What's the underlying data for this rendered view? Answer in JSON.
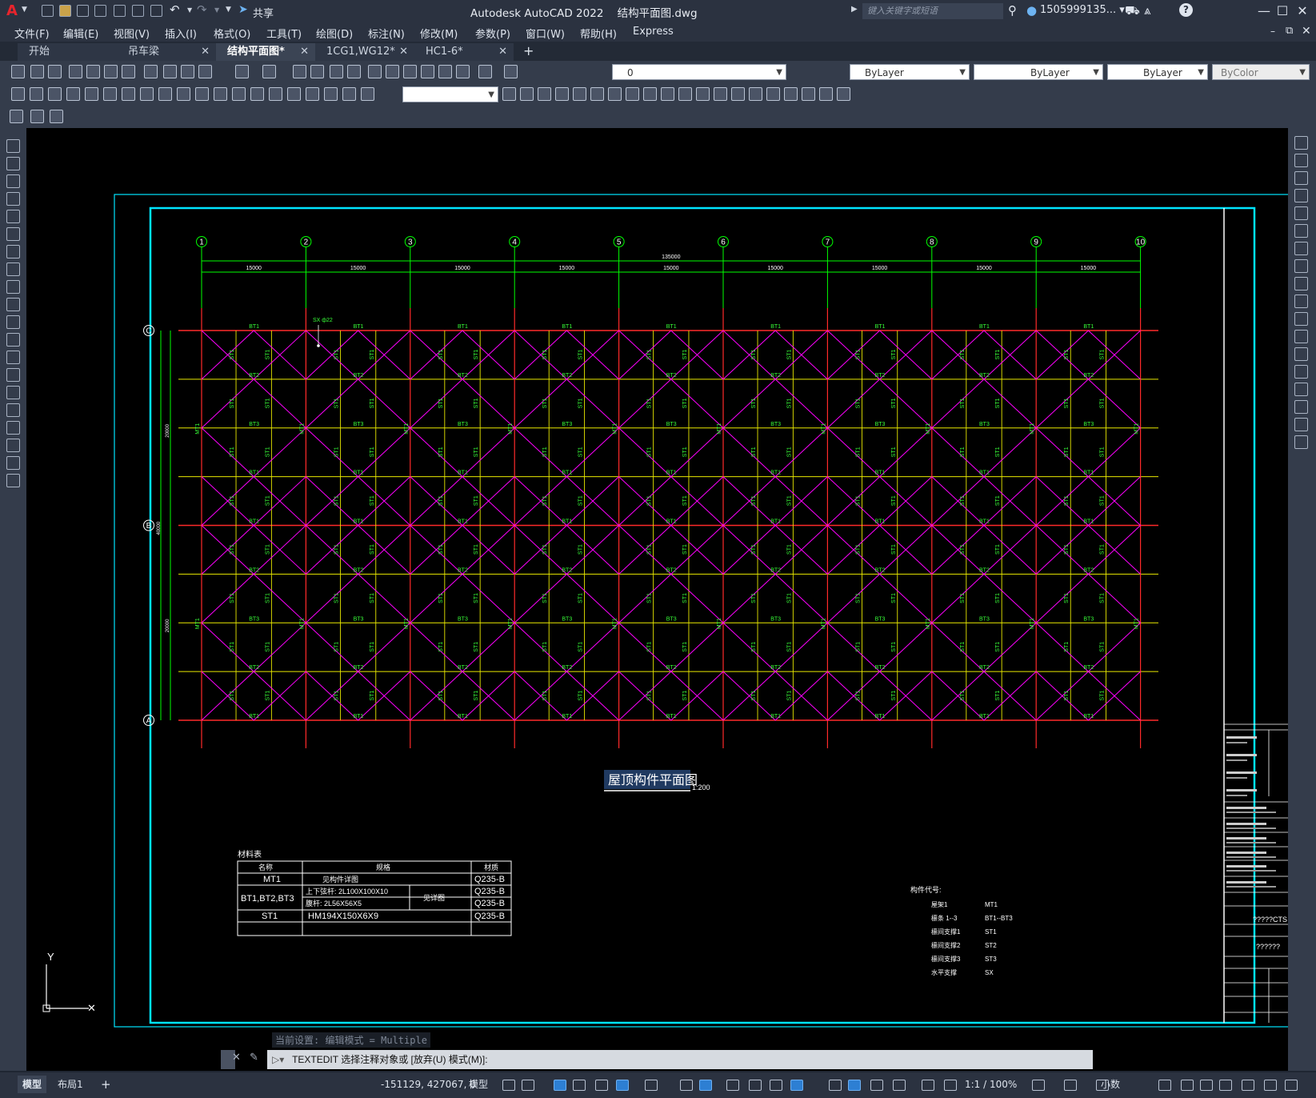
{
  "app": {
    "title": "Autodesk AutoCAD 2022    结构平面图.dwg",
    "share_label": "共享",
    "search_placeholder": "键入关键字或短语",
    "user_label": "1505999135... ▾",
    "logo_letter": "A"
  },
  "menu": [
    "文件(F)",
    "编辑(E)",
    "视图(V)",
    "插入(I)",
    "格式(O)",
    "工具(T)",
    "绘图(D)",
    "标注(N)",
    "修改(M)",
    "参数(P)",
    "窗口(W)",
    "帮助(H)",
    "Express"
  ],
  "tabs": [
    {
      "label": "开始",
      "active": false,
      "closable": false
    },
    {
      "label": "吊车梁",
      "active": false,
      "closable": true
    },
    {
      "label": "结构平面图*",
      "active": true,
      "closable": true
    },
    {
      "label": "1CG1,WG12*",
      "active": false,
      "closable": true
    },
    {
      "label": "HC1-6*",
      "active": false,
      "closable": true
    }
  ],
  "properties": {
    "layer": "0",
    "color": "ByLayer",
    "linetype": "ByLayer",
    "lineweight": "ByLayer",
    "plotstyle": "ByColor"
  },
  "drawing": {
    "axis_numbers": [
      "1",
      "2",
      "3",
      "4",
      "5",
      "6",
      "7",
      "8",
      "9",
      "10"
    ],
    "axis_letters": [
      "C",
      "B",
      "A"
    ],
    "span_dims": [
      "15000",
      "15000",
      "15000",
      "15000",
      "15000",
      "15000",
      "15000",
      "15000",
      "15000"
    ],
    "total_dim": "135000",
    "side_dims": [
      "20000",
      "20000",
      "40000"
    ],
    "callout": "SX ф22",
    "member_labels": {
      "top": "BT1",
      "mid2": "BT2",
      "mid3": "BT3",
      "strut": "ST1",
      "tie": "MT1"
    },
    "plan_title": "屋顶构件平面图",
    "plan_scale": "1:200"
  },
  "material_table": {
    "title": "材料表",
    "headers": [
      "名称",
      "规格",
      "材质"
    ],
    "rows": [
      {
        "name": "MT1",
        "spec": "见构件详图",
        "spec2": "",
        "note": "",
        "mat": [
          "Q235-B"
        ]
      },
      {
        "name": "BT1,BT2,BT3",
        "spec": "上下弦杆: 2L100X100X10",
        "spec2": "腹杆: 2L56X56X5",
        "note": "见详图",
        "mat": [
          "Q235-B",
          "Q235-B"
        ]
      },
      {
        "name": "ST1",
        "spec": "HM194X150X6X9",
        "spec2": "",
        "note": "",
        "mat": [
          "Q235-B"
        ]
      }
    ]
  },
  "legend": {
    "title": "构件代号:",
    "items": [
      {
        "name": "屋架1",
        "code": "MT1"
      },
      {
        "name": "檩条 1--3",
        "code": "BT1--BT3"
      },
      {
        "name": "檩间支撑1",
        "code": "ST1"
      },
      {
        "name": "檩间支撑2",
        "code": "ST2"
      },
      {
        "name": "檩间支撑3",
        "code": "ST3"
      },
      {
        "name": "水平支撑",
        "code": "SX"
      }
    ]
  },
  "titleblock": {
    "project_value": "?????CTS",
    "drawing_value": "??????"
  },
  "command": {
    "hint": "当前设置: 编辑模式 = Multiple",
    "prompt": "TEXTEDIT 选择注释对象或 [放弃(U) 模式(M)]:"
  },
  "status": {
    "model_tab": "模型",
    "layout_tab": "布局1",
    "coords": "-151129, 427067, 0",
    "space": "模型",
    "scale": "1:1 / 100%",
    "units": "小数"
  },
  "colors": {
    "border": "#00e5ff",
    "axis": "#00ff00",
    "grid_red": "#ff2a2a",
    "grid_yellow": "#e8e800",
    "brace": "#ff00ff",
    "label_green": "#38ff38"
  }
}
